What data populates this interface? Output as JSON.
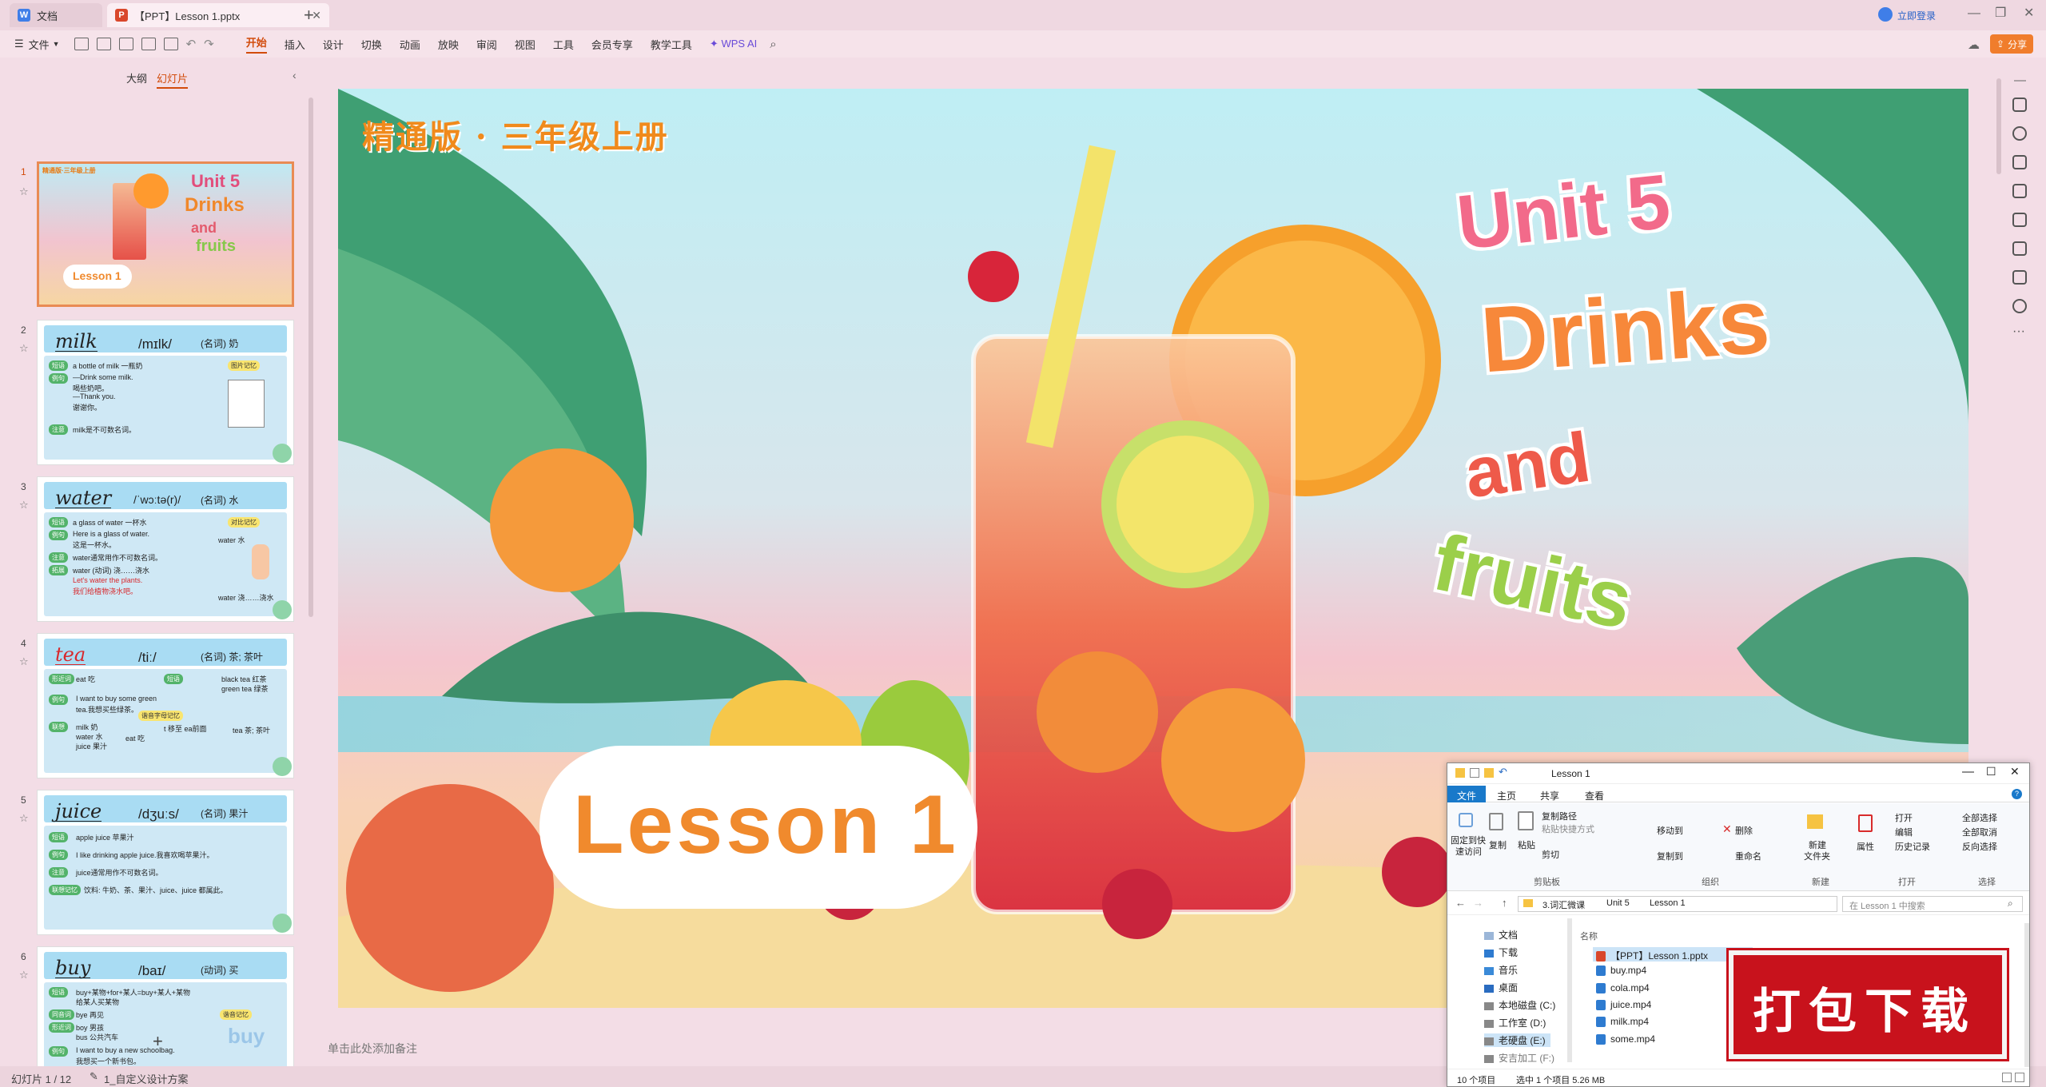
{
  "tabs": {
    "docs": "文档",
    "ppt": "【PPT】Lesson 1.pptx",
    "login": "立即登录"
  },
  "toolbar": {
    "file": "文件",
    "menus": [
      "开始",
      "插入",
      "设计",
      "切换",
      "动画",
      "放映",
      "审阅",
      "视图",
      "工具",
      "会员专享",
      "教学工具"
    ],
    "wpsai": "WPS AI",
    "share": "分享"
  },
  "panel": {
    "outline": "大纲",
    "slides": "幻灯片",
    "add": "+"
  },
  "thumbs": [
    {
      "num": "1",
      "title_top": "精通版·三年级上册",
      "lesson": "Lesson 1"
    },
    {
      "num": "2",
      "word": "milk",
      "ipa": "/mɪlk/",
      "pos": "(名词) 奶",
      "lines": [
        "a bottle of milk  一瓶奶",
        "—Drink some milk.",
        "  喝些奶吧。",
        "—Thank you.",
        "  谢谢你。",
        "milk是不可数名词。"
      ],
      "tags": [
        "短语",
        "例句",
        "注意",
        "图片记忆"
      ]
    },
    {
      "num": "3",
      "word": "water",
      "ipa": "/ˈwɔːtə(r)/",
      "pos": "(名词) 水",
      "lines": [
        "a glass of water  一杯水",
        "Here is a glass of water.",
        "这是一杯水。",
        "water通常用作不可数名词。",
        "water (动词) 浇……浇水",
        "Let's water the plants.",
        "我们给植物浇水吧。",
        "water  水",
        "water  浇……浇水"
      ],
      "tags": [
        "短语",
        "例句",
        "注意",
        "拓展",
        "对比记忆"
      ]
    },
    {
      "num": "4",
      "word": "tea",
      "ipa": "/tiː/",
      "pos": "(名词) 茶; 茶叶",
      "lines": [
        "eat  吃",
        "black tea  红茶",
        "green tea  绿茶",
        "I want to buy some green",
        "tea.我想买些绿茶。",
        "milk  奶",
        "water  水",
        "juice  果汁",
        "tea  茶; 茶叶",
        "eat  吃",
        "t 移至 ea前面"
      ],
      "tags": [
        "形近词",
        "短语",
        "例句",
        "联想",
        "谐音字母记忆"
      ]
    },
    {
      "num": "5",
      "word": "juice",
      "ipa": "/dʒuːs/",
      "pos": "(名词) 果汁",
      "lines": [
        "apple juice  苹果汁",
        "I like drinking apple juice.我喜欢喝苹果汁。",
        "juice通常用作不可数名词。",
        "饮料: 牛奶、茶、果汁、juice、juice 都属此。"
      ],
      "tags": [
        "短语",
        "例句",
        "注意",
        "联想记忆"
      ]
    },
    {
      "num": "6",
      "word": "buy",
      "ipa": "/baɪ/",
      "pos": "(动词) 买",
      "lines": [
        "buy+某物+for+某人=buy+某人+某物",
        "给某人买某物",
        "bye  再见",
        "boy  男孩",
        "bus  公共汽车",
        "I want to buy a new schoolbag.",
        "我想买一个新书包。"
      ],
      "tags": [
        "短语",
        "同音词",
        "形近词",
        "例句",
        "谐音记忆"
      ]
    }
  ],
  "slide": {
    "edition": "精通版 · 三年级上册",
    "unit": "Unit 5",
    "drinks": "Drinks",
    "and": "and",
    "fruits": "fruits",
    "lesson": "Lesson 1"
  },
  "notes": "单击此处添加备注",
  "status": {
    "slide_info": "幻灯片 1 / 12",
    "template": "1_自定义设计方案"
  },
  "explorer": {
    "title": "Lesson 1",
    "ribbon_tabs": [
      "文件",
      "主页",
      "共享",
      "查看"
    ],
    "clipboard": [
      "固定到快",
      "速访问",
      "复制",
      "粘贴",
      "复制路径",
      "粘贴快捷方式",
      "剪切"
    ],
    "organize": [
      "移动到",
      "复制到",
      "删除",
      "重命名"
    ],
    "new": [
      "新建",
      "文件夹"
    ],
    "open": [
      "属性",
      "打开",
      "编辑",
      "历史记录"
    ],
    "select": [
      "全部选择",
      "全部取消",
      "反向选择"
    ],
    "groups": [
      "剪贴板",
      "组织",
      "新建",
      "打开",
      "选择"
    ],
    "breadcrumb": [
      "3.词汇微课",
      "Unit 5",
      "Lesson 1"
    ],
    "search_placeholder": "在 Lesson 1 中搜索",
    "col_name": "名称",
    "nav": [
      "文档",
      "下载",
      "音乐",
      "桌面",
      "本地磁盘 (C:)",
      "工作室 (D:)",
      "老硬盘 (E:)",
      "安吉加工 (F:)"
    ],
    "files": [
      "【PPT】Lesson 1.pptx",
      "buy.mp4",
      "cola.mp4",
      "juice.mp4",
      "milk.mp4",
      "some.mp4"
    ],
    "status_count": "10 个项目",
    "status_sel": "选中 1 个项目  5.26 MB"
  },
  "download_banner": "打包下载"
}
